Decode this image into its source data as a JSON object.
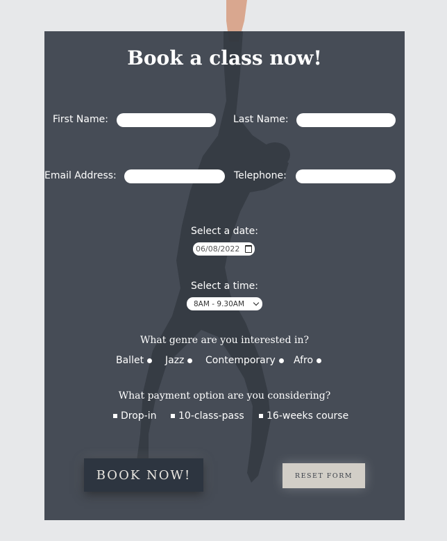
{
  "form": {
    "title": "Book a class now!",
    "first_name_label": "First Name:",
    "last_name_label": "Last Name:",
    "email_label": "Email Address:",
    "telephone_label": "Telephone:",
    "first_name_value": "",
    "last_name_value": "",
    "email_value": "",
    "telephone_value": "",
    "date_label": "Select a date:",
    "date_value": "06/08/2022",
    "time_label": "Select a time:",
    "time_value": "8AM - 9.30AM",
    "genre_question": "What genre are you interested in?",
    "genres": [
      "Ballet",
      "Jazz",
      "Contemporary",
      "Afro"
    ],
    "payment_question": "What payment option are you considering?",
    "payments": [
      "Drop-in",
      "10-class-pass",
      "16-weeks course"
    ],
    "book_button": "BOOK NOW!",
    "reset_button": "RESET FORM"
  },
  "colors": {
    "page_bg": "#e7e8ea",
    "panel_bg": "#39404a",
    "book_button_bg": "#2d3540",
    "reset_button_bg": "#d2cec7"
  },
  "icons": {
    "date_picker": "calendar-icon",
    "time_select": "chevron-down-icon"
  }
}
